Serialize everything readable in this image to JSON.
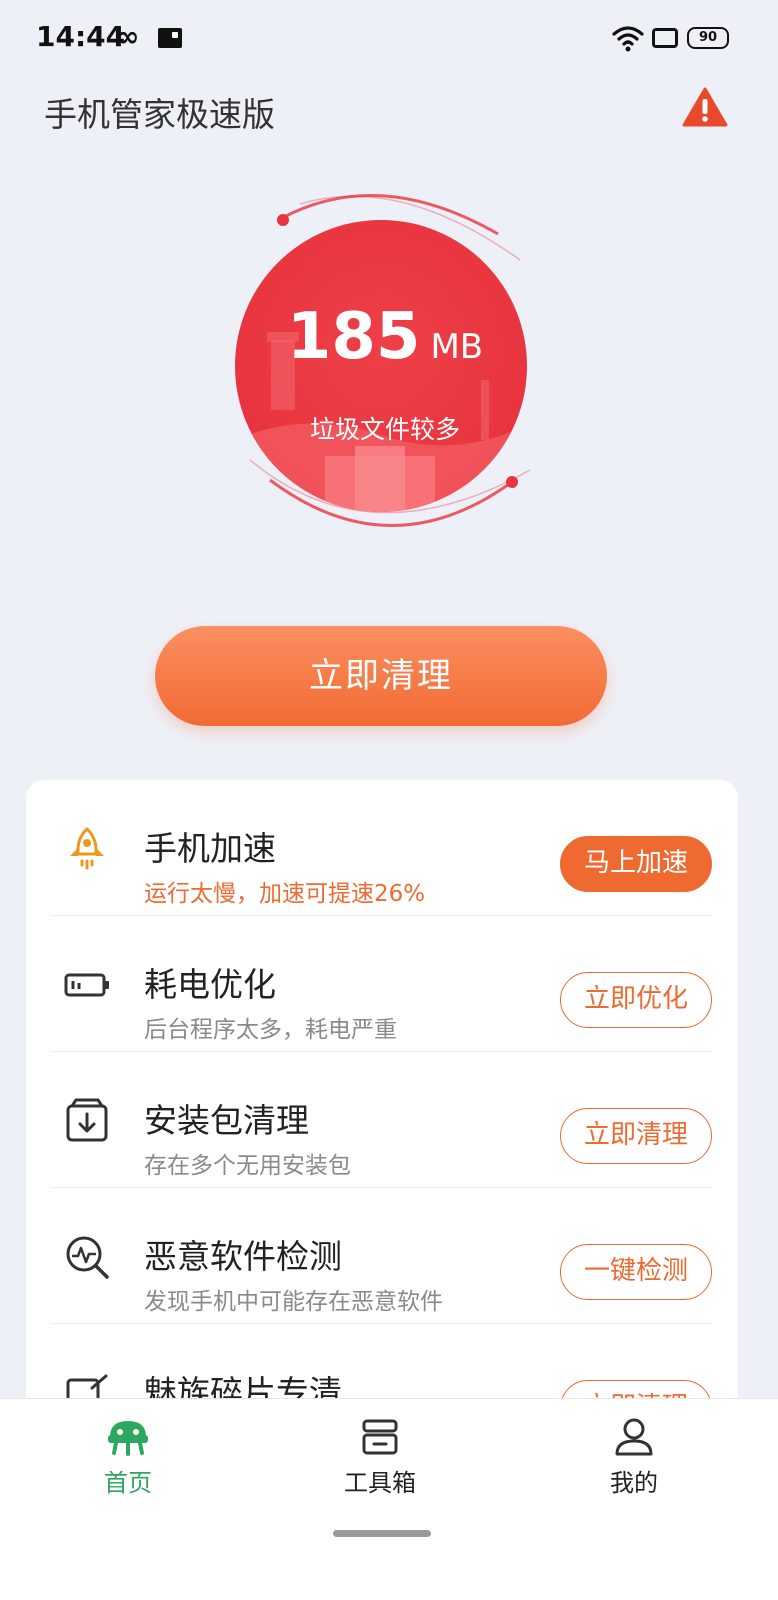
{
  "status_bar": {
    "time": "14:44",
    "battery": "90"
  },
  "header": {
    "title": "手机管家极速版"
  },
  "hero": {
    "value": "185",
    "unit": "MB",
    "subtitle": "垃圾文件较多"
  },
  "primary_action": {
    "label": "立即清理"
  },
  "features": [
    {
      "icon": "rocket-icon",
      "title": "手机加速",
      "subtitle": "运行太慢，加速可提速26%",
      "button": "马上加速"
    },
    {
      "icon": "battery-icon",
      "title": "耗电优化",
      "subtitle": "后台程序太多，耗电严重",
      "button": "立即优化"
    },
    {
      "icon": "package-download-icon",
      "title": "安装包清理",
      "subtitle": "存在多个无用安装包",
      "button": "立即清理"
    },
    {
      "icon": "malware-scan-icon",
      "title": "恶意软件检测",
      "subtitle": "发现手机中可能存在恶意软件",
      "button": "一键检测"
    },
    {
      "icon": "fragment-icon",
      "title": "魅族碎片专清",
      "subtitle": "",
      "button": "立即清理"
    }
  ],
  "bottom_nav": {
    "items": [
      {
        "label": "首页",
        "icon": "home-robot-icon",
        "active": true
      },
      {
        "label": "工具箱",
        "icon": "toolbox-icon",
        "active": false
      },
      {
        "label": "我的",
        "icon": "profile-icon",
        "active": false
      }
    ]
  },
  "colors": {
    "accent": "#ee6a30",
    "hero_red": "#e8343e",
    "nav_active": "#2ea860",
    "background": "#eef0f7"
  }
}
